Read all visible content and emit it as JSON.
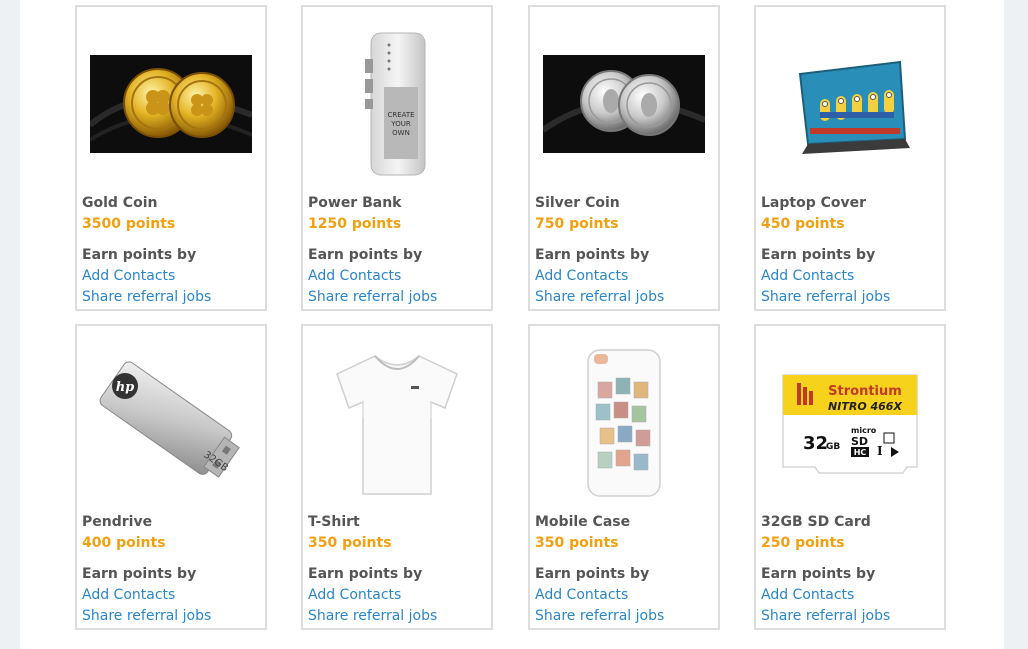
{
  "rewards": [
    {
      "name": "Gold Coin",
      "points": "3500 points",
      "earn_label": "Earn points by",
      "link1": "Add Contacts",
      "link2": "Share referral jobs"
    },
    {
      "name": "Power Bank",
      "points": "1250 points",
      "earn_label": "Earn points by",
      "link1": "Add Contacts",
      "link2": "Share referral jobs",
      "img_text": [
        "CREATE",
        "YOUR",
        "OWN"
      ]
    },
    {
      "name": "Silver Coin",
      "points": "750 points",
      "earn_label": "Earn points by",
      "link1": "Add Contacts",
      "link2": "Share referral jobs"
    },
    {
      "name": "Laptop Cover",
      "points": "450 points",
      "earn_label": "Earn points by",
      "link1": "Add Contacts",
      "link2": "Share referral jobs"
    },
    {
      "name": "Pendrive",
      "points": "400 points",
      "earn_label": "Earn points by",
      "link1": "Add Contacts",
      "link2": "Share referral jobs",
      "img_text": [
        "hp",
        "32GB"
      ]
    },
    {
      "name": "T-Shirt",
      "points": "350 points",
      "earn_label": "Earn points by",
      "link1": "Add Contacts",
      "link2": "Share referral jobs"
    },
    {
      "name": "Mobile Case",
      "points": "350 points",
      "earn_label": "Earn points by",
      "link1": "Add Contacts",
      "link2": "Share referral jobs"
    },
    {
      "name": "32GB SD Card",
      "points": "250 points",
      "earn_label": "Earn points by",
      "link1": "Add Contacts",
      "link2": "Share referral jobs",
      "img_text": [
        "Strontium",
        "NITRO 466X",
        "32",
        "GB",
        "micro",
        "SD",
        "HC",
        "I"
      ]
    }
  ],
  "colors": {
    "points": "#f0a010",
    "link": "#2a86c8",
    "text": "#555555",
    "border": "#dddddd"
  }
}
